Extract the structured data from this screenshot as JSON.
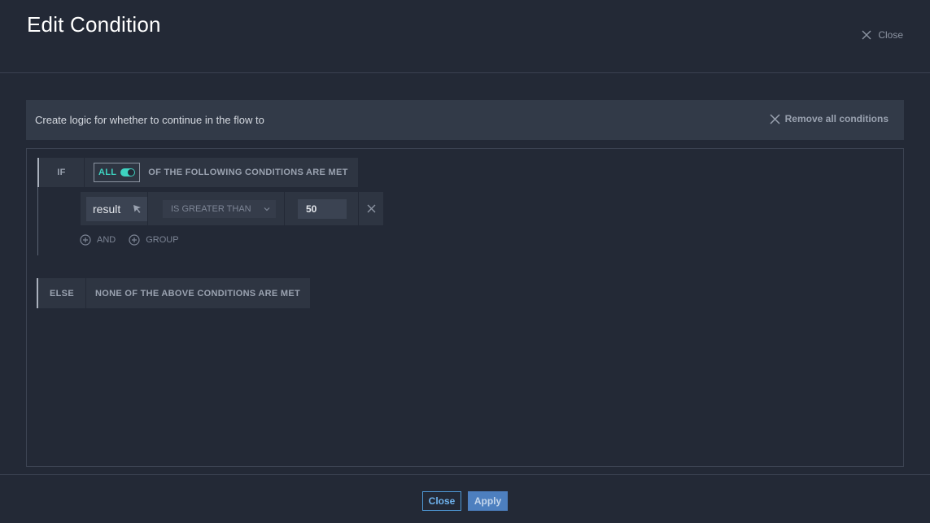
{
  "header": {
    "title": "Edit Condition",
    "close_label": "Close"
  },
  "banner": {
    "text": "Create logic for whether to continue in the flow to",
    "remove_all_label": "Remove all conditions"
  },
  "if_block": {
    "if_label": "IF",
    "match_mode": "ALL",
    "match_toggle_on": true,
    "condition_suffix": "OF THE FOLLOWING CONDITIONS ARE MET",
    "conditions": [
      {
        "field": "result",
        "operator": "IS GREATER THAN",
        "value": "50"
      }
    ],
    "add_and_label": "AND",
    "add_group_label": "GROUP"
  },
  "else_block": {
    "else_label": "ELSE",
    "text": "NONE OF THE ABOVE CONDITIONS ARE MET"
  },
  "footer": {
    "close_label": "Close",
    "apply_label": "Apply"
  },
  "colors": {
    "background": "#232936",
    "accent_teal": "#3ed3c1",
    "primary_blue": "#4d7fbf",
    "outline_blue": "#4f9ad8"
  }
}
